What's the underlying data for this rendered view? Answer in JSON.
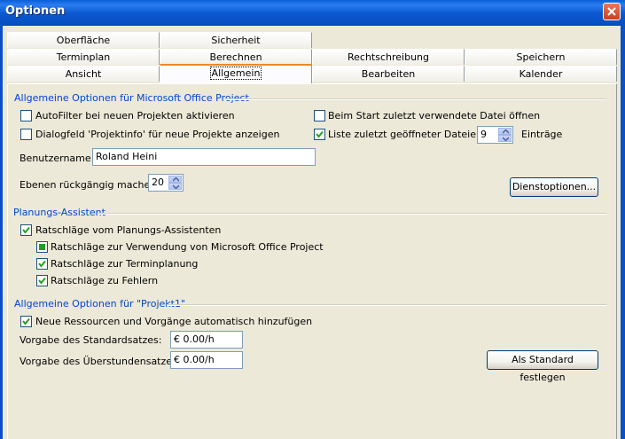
{
  "window": {
    "title": "Optionen"
  },
  "tabs": {
    "row1": [
      "Oberfläche",
      "Sicherheit"
    ],
    "row2": [
      "Terminplan",
      "Berechnen",
      "Rechtschreibung",
      "Speichern"
    ],
    "row3": [
      "Ansicht",
      "Allgemein",
      "Bearbeiten",
      "Kalender"
    ],
    "active": "Allgemein"
  },
  "general": {
    "group_title": "Allgemeine Optionen für Microsoft Office Project",
    "autofilter": {
      "label": "AutoFilter bei neuen Projekten aktivieren",
      "checked": false
    },
    "start_last_file": {
      "label": "Beim Start zuletzt verwendete Datei öffnen",
      "checked": false
    },
    "projectinfo_dialog": {
      "label": "Dialogfeld 'Projektinfo' für neue Projekte anzeigen",
      "checked": false
    },
    "recent_files": {
      "label": "Liste zuletzt geöffneter Dateien:",
      "checked": true,
      "value": "9",
      "suffix": "Einträge"
    },
    "username": {
      "label": "Benutzername:",
      "value": "Roland Heini"
    },
    "undo_levels": {
      "label": "Ebenen rückgängig machen:",
      "value": "20"
    },
    "service_options_button": "Dienstoptionen..."
  },
  "planning": {
    "group_title": "Planungs-Assistent",
    "advice_from_assistant": {
      "label": "Ratschläge vom Planungs-Assistenten",
      "checked": true
    },
    "advice_usage": {
      "label": "Ratschläge zur Verwendung von Microsoft Office Project",
      "state": "indeterminate"
    },
    "advice_scheduling": {
      "label": "Ratschläge zur Terminplanung",
      "checked": true
    },
    "advice_errors": {
      "label": "Ratschläge zu Fehlern",
      "checked": true
    }
  },
  "project": {
    "group_title": "Allgemeine Optionen für \"Projekt1\"",
    "auto_add": {
      "label": "Neue Ressourcen und Vorgänge automatisch hinzufügen",
      "checked": true
    },
    "standard_rate": {
      "label": "Vorgabe des Standardsatzes:",
      "value": "€ 0.00/h"
    },
    "overtime_rate": {
      "label": "Vorgabe des Überstundensatzes:",
      "value": "€ 0.00/h"
    },
    "set_default_button": "Als Standard festlegen"
  },
  "colors": {
    "titlebar": "#0a58d0",
    "group_title": "#0046d5",
    "dialog_bg": "#ece9d8",
    "active_tab_accent": "#e68b2c"
  }
}
